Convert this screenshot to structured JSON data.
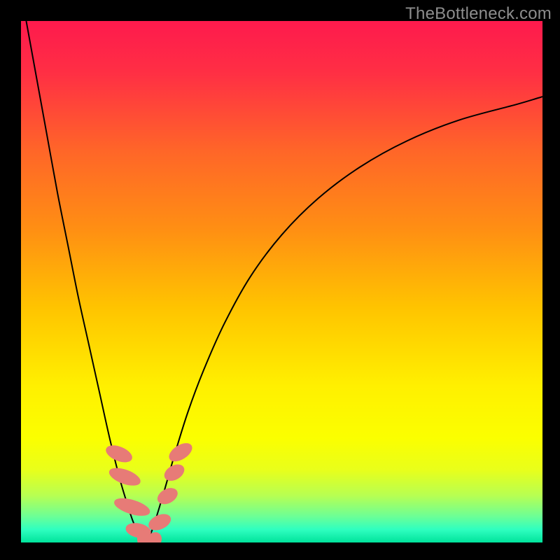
{
  "watermark": "TheBottleneck.com",
  "colors": {
    "frame": "#000000",
    "curve": "#000000",
    "marker_fill": "#e77b77",
    "marker_stroke": "#e77b77",
    "gradient_stops": [
      {
        "offset": 0.0,
        "color": "#fe1a4d"
      },
      {
        "offset": 0.1,
        "color": "#ff2f44"
      },
      {
        "offset": 0.25,
        "color": "#ff6628"
      },
      {
        "offset": 0.4,
        "color": "#ff8f13"
      },
      {
        "offset": 0.55,
        "color": "#ffc400"
      },
      {
        "offset": 0.7,
        "color": "#fff000"
      },
      {
        "offset": 0.8,
        "color": "#fbff00"
      },
      {
        "offset": 0.86,
        "color": "#e9ff1a"
      },
      {
        "offset": 0.91,
        "color": "#b7ff52"
      },
      {
        "offset": 0.95,
        "color": "#6cff96"
      },
      {
        "offset": 0.975,
        "color": "#2fffc0"
      },
      {
        "offset": 1.0,
        "color": "#00e39b"
      }
    ]
  },
  "chart_data": {
    "type": "line",
    "title": "",
    "xlabel": "",
    "ylabel": "",
    "xlim": [
      0,
      100
    ],
    "ylim": [
      0,
      100
    ],
    "grid": false,
    "legend": false,
    "series": [
      {
        "name": "bottleneck-curve-left",
        "x": [
          1,
          3,
          5,
          7,
          9,
          11,
          13,
          15,
          17,
          19,
          20.5,
          21.5,
          22.5,
          23.2
        ],
        "y": [
          100,
          89,
          78,
          67,
          57,
          47,
          38,
          29,
          20,
          12,
          7,
          4,
          2,
          0.5
        ]
      },
      {
        "name": "bottleneck-curve-right",
        "x": [
          24.2,
          25,
          26,
          27.5,
          29.5,
          32,
          35,
          39,
          44,
          50,
          57,
          65,
          74,
          84,
          95,
          100
        ],
        "y": [
          0.5,
          2,
          5,
          10,
          17,
          25,
          33,
          42,
          51,
          59,
          66,
          72,
          77,
          81,
          84,
          85.5
        ]
      }
    ],
    "markers": [
      {
        "x": 18.8,
        "y": 17.0,
        "rx": 1.3,
        "ry": 2.6,
        "angle": -68
      },
      {
        "x": 19.9,
        "y": 12.6,
        "rx": 1.3,
        "ry": 3.1,
        "angle": -70
      },
      {
        "x": 21.3,
        "y": 6.8,
        "rx": 1.3,
        "ry": 3.5,
        "angle": -73
      },
      {
        "x": 22.5,
        "y": 2.3,
        "rx": 1.3,
        "ry": 2.4,
        "angle": -78
      },
      {
        "x": 23.7,
        "y": 0.3,
        "rx": 1.3,
        "ry": 2.0,
        "angle": -15
      },
      {
        "x": 25.5,
        "y": 0.4,
        "rx": 1.3,
        "ry": 1.6,
        "angle": 35
      },
      {
        "x": 26.6,
        "y": 3.9,
        "rx": 1.3,
        "ry": 2.2,
        "angle": 66
      },
      {
        "x": 28.1,
        "y": 8.9,
        "rx": 1.3,
        "ry": 2.0,
        "angle": 62
      },
      {
        "x": 29.4,
        "y": 13.4,
        "rx": 1.3,
        "ry": 2.0,
        "angle": 60
      },
      {
        "x": 30.6,
        "y": 17.3,
        "rx": 1.3,
        "ry": 2.4,
        "angle": 58
      }
    ],
    "min_point": {
      "x": 23.7,
      "y": 0
    }
  }
}
